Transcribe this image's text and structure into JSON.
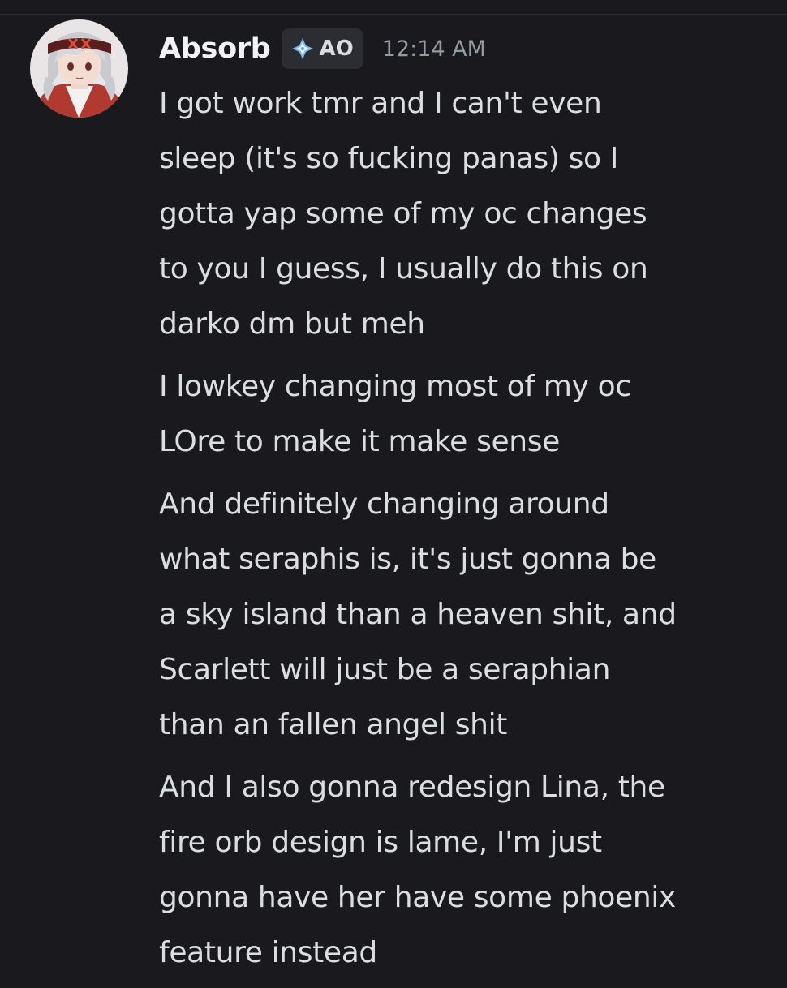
{
  "message": {
    "author": "Absorb",
    "badge": {
      "icon": "sparkle-diamond-icon",
      "text": "AO"
    },
    "timestamp": "12:14 AM",
    "lines": [
      "I got work tmr and I can't even\nsleep (it's so fucking panas) so I\ngotta yap some of my oc changes\nto you I guess, I usually do this on\ndarko dm but meh",
      "I lowkey changing most of my oc\nLOre to make it make sense",
      "And definitely changing around\nwhat seraphis is, it's just gonna be\na sky island than a heaven shit, and\nScarlett will just be a seraphian\nthan an fallen angel shit",
      "And I also gonna redesign Lina, the\nfire orb design is lame, I'm just\ngonna have her have some phoenix\nfeature instead"
    ]
  },
  "colors": {
    "background": "#1a1a1e",
    "username": "#f2f3f5",
    "text": "#dbdee1",
    "timestamp": "#949ba4",
    "badge_bg": "#2b2d33"
  }
}
